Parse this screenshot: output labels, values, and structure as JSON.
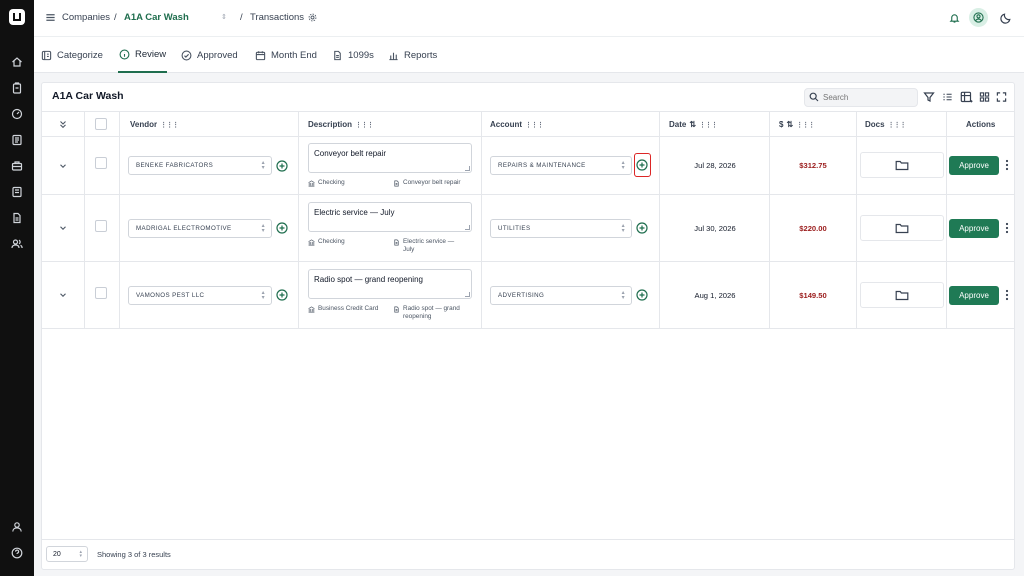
{
  "header": {
    "companies_label": "Companies",
    "separator": "/",
    "company_name": "A1A Car Wash",
    "page_label": "Transactions"
  },
  "tabs": [
    {
      "label": "Categorize",
      "icon": "categorize-icon"
    },
    {
      "label": "Review",
      "icon": "info-icon",
      "active": true
    },
    {
      "label": "Approved",
      "icon": "check-circle-icon"
    },
    {
      "label": "Month End",
      "icon": "calendar-icon"
    },
    {
      "label": "1099s",
      "icon": "document-icon"
    },
    {
      "label": "Reports",
      "icon": "bar-chart-icon"
    }
  ],
  "card": {
    "title": "A1A Car Wash",
    "search_placeholder": "Search"
  },
  "columns": {
    "vendor": "Vendor",
    "description": "Description",
    "account": "Account",
    "date": "Date",
    "amount": "$",
    "docs": "Docs",
    "actions": "Actions"
  },
  "rows": [
    {
      "vendor": "BENEKE FABRICATORS",
      "description": "Conveyor belt repair",
      "payment": "Checking",
      "memo": "Conveyor belt repair",
      "account": "REPAIRS & MAINTENANCE",
      "date": "Jul 28, 2026",
      "amount": "$312.75",
      "action": "Approve"
    },
    {
      "vendor": "MADRIGAL ELECTROMOTIVE",
      "description": "Electric service — July",
      "payment": "Checking",
      "memo": "Electric service —\nJuly",
      "account": "UTILITIES",
      "date": "Jul 30, 2026",
      "amount": "$220.00",
      "action": "Approve"
    },
    {
      "vendor": "VAMONOS PEST LLC",
      "description": "Radio spot — grand reopening",
      "payment": "Business Credit Card",
      "memo": "Radio spot — grand\nreopening",
      "account": "ADVERTISING",
      "date": "Aug 1, 2026",
      "amount": "$149.50",
      "action": "Approve"
    }
  ],
  "footer": {
    "page_size": "20",
    "showing_text": "Showing 3 of 3 results"
  },
  "colors": {
    "accent": "#1f6e4e",
    "approve_button": "#1f7a55",
    "amount_text": "#9b1c1c",
    "highlight": "#dc2626",
    "rail": "#101010"
  }
}
